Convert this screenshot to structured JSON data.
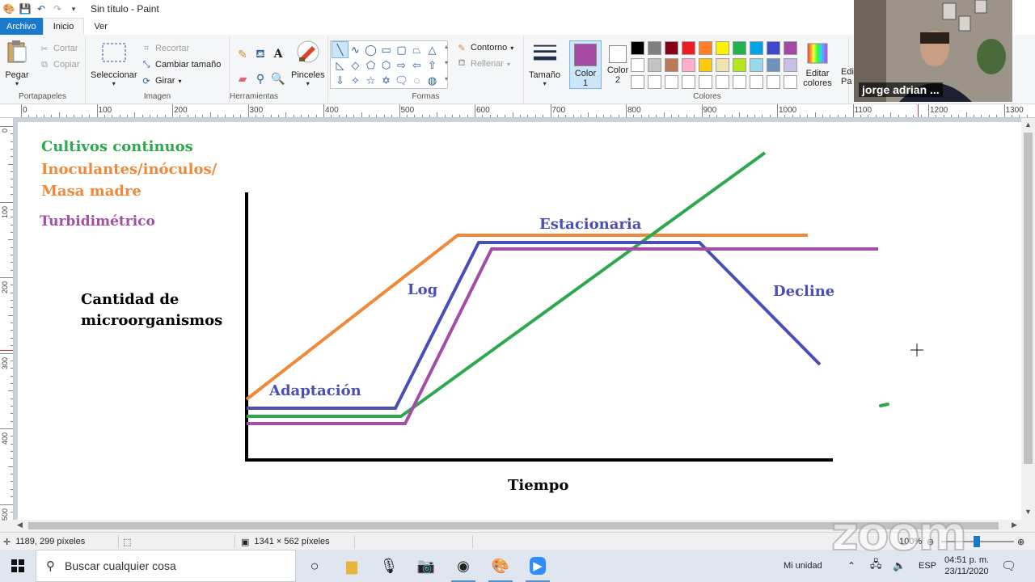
{
  "window": {
    "title": "Sin título - Paint"
  },
  "menu": {
    "file": "Archivo",
    "home": "Inicio",
    "view": "Ver"
  },
  "ribbon": {
    "clipboard": {
      "label": "Portapapeles",
      "paste": "Pegar",
      "cut": "Cortar",
      "copy": "Copiar"
    },
    "image": {
      "label": "Imagen",
      "select": "Seleccionar",
      "crop": "Recortar",
      "resize": "Cambiar tamaño",
      "rotate": "Girar"
    },
    "tools": {
      "label": "Herramientas",
      "brushes": "Pinceles"
    },
    "shapes": {
      "label": "Formas",
      "outline": "Contorno",
      "fill": "Rellenar"
    },
    "size": {
      "label": "Tamaño"
    },
    "colors": {
      "label": "Colores",
      "color1": "Color",
      "color1_num": "1",
      "color2": "Color",
      "color2_num": "2",
      "edit": "Editar colores",
      "color1_value": "#a349a4",
      "color2_value": "#ffffff",
      "palette": [
        "#000000",
        "#7f7f7f",
        "#880015",
        "#ed1c24",
        "#ff7f27",
        "#fff200",
        "#22b14c",
        "#00a2e8",
        "#3f48cc",
        "#a349a4",
        "#ffffff",
        "#c3c3c3",
        "#b97a57",
        "#ffaec9",
        "#ffc90e",
        "#efe4b0",
        "#b5e61d",
        "#99d9ea",
        "#7092be",
        "#c8bfe7",
        "#ffffff",
        "#ffffff",
        "#ffffff",
        "#ffffff",
        "#ffffff",
        "#ffffff",
        "#ffffff",
        "#ffffff",
        "#ffffff",
        "#ffffff"
      ]
    },
    "paint3d": "Edi Pa"
  },
  "ruler": {
    "h": [
      "0",
      "100",
      "200",
      "300",
      "400",
      "500",
      "600",
      "700",
      "800",
      "900",
      "1000",
      "1100",
      "1200",
      "1300"
    ],
    "v": [
      "0",
      "100",
      "200",
      "300",
      "400",
      "500"
    ]
  },
  "canvas": {
    "legend_continuous": "Cultivos continuos",
    "legend_inoculants_1": "Inoculantes/inóculos/",
    "legend_inoculants_2": "Masa madre",
    "legend_turbidimetric": "Turbidimétrico",
    "y_label_1": "Cantidad de",
    "y_label_2": "microorganismos",
    "x_label": "Tiempo",
    "phase_adaptation": "Adaptación",
    "phase_log": "Log",
    "phase_stationary": "Estacionaria",
    "phase_decline": "Decline",
    "colors": {
      "green": "#2ea84f",
      "orange": "#f0883a",
      "purple": "#a34ca8",
      "blue": "#4b4fb3",
      "axis": "#000000"
    }
  },
  "status": {
    "cursor": "1189, 299 píxeles",
    "size": "1341 × 562 píxeles",
    "zoom": "100%"
  },
  "taskbar": {
    "search_placeholder": "Buscar cualquier cosa",
    "unit": "Mi unidad",
    "lang": "ESP",
    "time": "04:51 p. m.",
    "date": "23/11/2020"
  },
  "zoom": {
    "participant": "jorge adrian ...",
    "logo": "zoom"
  }
}
